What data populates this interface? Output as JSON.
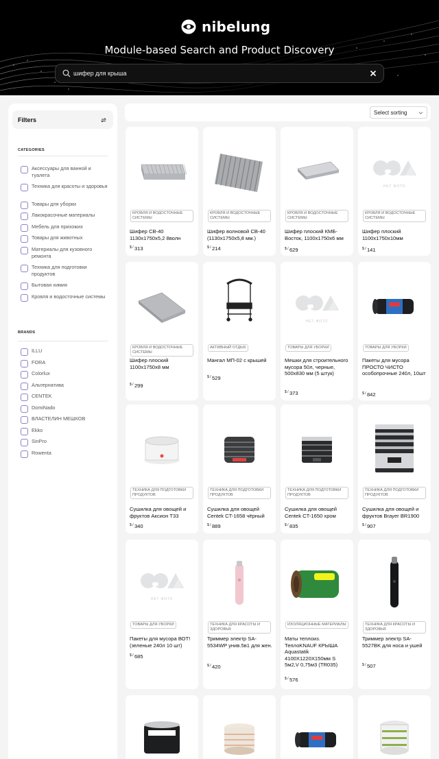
{
  "brand": {
    "name": "nibelung"
  },
  "hero": {
    "title": "Module-based Search and Product Discovery"
  },
  "search": {
    "value": "шифер для крыша",
    "icon": "search-icon",
    "clear_icon": "close-icon"
  },
  "filters": {
    "title": "Filters",
    "reset_icon": "refresh-icon",
    "categories_title": "CATEGORIES",
    "categories": [
      "Аксессуары для ванной и туалета",
      "Техника для красоты и здоровья",
      "Товары для уборки",
      "Лакокрасочные материалы",
      "Мебель для прихожих",
      "Товары для животных",
      "Материалы для кузовного ремонта",
      "Техника для подготовки продуктов",
      "Бытовая химия",
      "Кровля и водосточные системы"
    ],
    "brands_title": "BRANDS",
    "brands": [
      "ILLU",
      "FORA",
      "Colorlux",
      "Альтернатива",
      "CENTEK",
      "DomiNado",
      "ВЛАСТЕЛИН МЕШКОВ",
      "Ekko",
      "SinPro",
      "Rowenta"
    ]
  },
  "sort": {
    "label": "Select sorting"
  },
  "placeholder_text": "НЕТ ФОТО",
  "currency": "$",
  "products": [
    {
      "category": "КРОВЛЯ И ВОДОСТОЧНЫЕ СИСТЕМЫ",
      "name": "Шифер СВ-40 1130x1750x5,2 8волн",
      "price": "313",
      "image": "slate-stack-image"
    },
    {
      "category": "КРОВЛЯ И ВОДОСТОЧНЫЕ СИСТЕМЫ",
      "name": "Шифер волновой СВ-40 (1130x1750x5,8 мм.)",
      "price": "214",
      "image": "corrugated-sheet-image"
    },
    {
      "category": "КРОВЛЯ И ВОДОСТОЧНЫЕ СИСТЕМЫ",
      "name": "Шифер плоский КМБ-Восток, 1100x1750x6 мм",
      "price": "629",
      "image": "flat-slate-image"
    },
    {
      "category": "КРОВЛЯ И ВОДОСТОЧНЫЕ СИСТЕМЫ",
      "name": "Шифер плоский 1100x1750x10мм",
      "price": "141",
      "image": "no-photo-image"
    },
    {
      "category": "КРОВЛЯ И ВОДОСТОЧНЫЕ СИСТЕМЫ",
      "name": "Шифер плоский 1100x1750x8 мм",
      "price": "299",
      "image": "flat-slate-stack-image"
    },
    {
      "category": "АКТИВНЫЙ ОТДЫХ",
      "name": "Мангал МП-02 с крышей",
      "price": "529",
      "image": "grill-with-roof-image"
    },
    {
      "category": "ТОВАРЫ ДЛЯ УБОРКИ",
      "name": "Мешки для строительного мусора 50л, черные, 500x830 мм (5 штук)",
      "price": "373",
      "image": "no-photo-image"
    },
    {
      "category": "ТОВАРЫ ДЛЯ УБОРКИ",
      "name": "Пакеты для мусора ПРОСТО ЧИСТО особопрочные 240л, 10шт",
      "price": "842",
      "image": "trash-bag-roll-image"
    },
    {
      "category": "ТЕХНИКА ДЛЯ ПОДГОТОВКИ ПРОДУКТОВ",
      "name": "Сушилка для овощей и фруктов Аксион Т33",
      "price": "340",
      "image": "white-dryer-image"
    },
    {
      "category": "ТЕХНИКА ДЛЯ ПОДГОТОВКИ ПРОДУКТОВ",
      "name": "Сушилка для овощей Centek CT-1658 чёрный",
      "price": "889",
      "image": "black-dryer-image"
    },
    {
      "category": "ТЕХНИКА ДЛЯ ПОДГОТОВКИ ПРОДУКТОВ",
      "name": "Сушилка для овощей Centek CT-1650 хром",
      "price": "835",
      "image": "chrome-dryer-image"
    },
    {
      "category": "ТЕХНИКА ДЛЯ ПОДГОТОВКИ ПРОДУКТОВ",
      "name": "Сушилка для овощей и фруктов Brayer BR1900",
      "price": "907",
      "image": "steel-dryer-image"
    },
    {
      "category": "ТОВАРЫ ДЛЯ УБОРКИ",
      "name": "Пакеты для мусора ВОТ! (зеленые 240л 10 шт)",
      "price": "685",
      "image": "no-photo-image"
    },
    {
      "category": "ТЕХНИКА ДЛЯ КРАСОТЫ И ЗДОРОВЬЯ",
      "name": "Триммер электр SA-5534WP унив.5в1 для жен.",
      "price": "420",
      "image": "pink-trimmer-image"
    },
    {
      "category": "ИЗОЛЯЦИОННЫЕ МАТЕРИАЛЫ",
      "name": "Маты теплоиз. ТеплоKNAUF КРЫША Aquastatik 4100X1220X150мм S 5м2,V 0,75м3 (TR035)",
      "price": "576",
      "image": "insulation-roll-image"
    },
    {
      "category": "ТЕХНИКА ДЛЯ КРАСОТЫ И ЗДОРОВЬЯ",
      "name": "Триммер электр SA-5527BK для носа и ушей",
      "price": "507",
      "image": "nose-trimmer-image"
    },
    {
      "category": "",
      "name": "",
      "price": "",
      "image": "paint-bucket-image"
    },
    {
      "category": "",
      "name": "",
      "price": "",
      "image": "round-dryer-image"
    },
    {
      "category": "",
      "name": "",
      "price": "",
      "image": "trash-bag-roll-image"
    },
    {
      "category": "",
      "name": "",
      "price": "",
      "image": "glass-dryer-image"
    }
  ]
}
